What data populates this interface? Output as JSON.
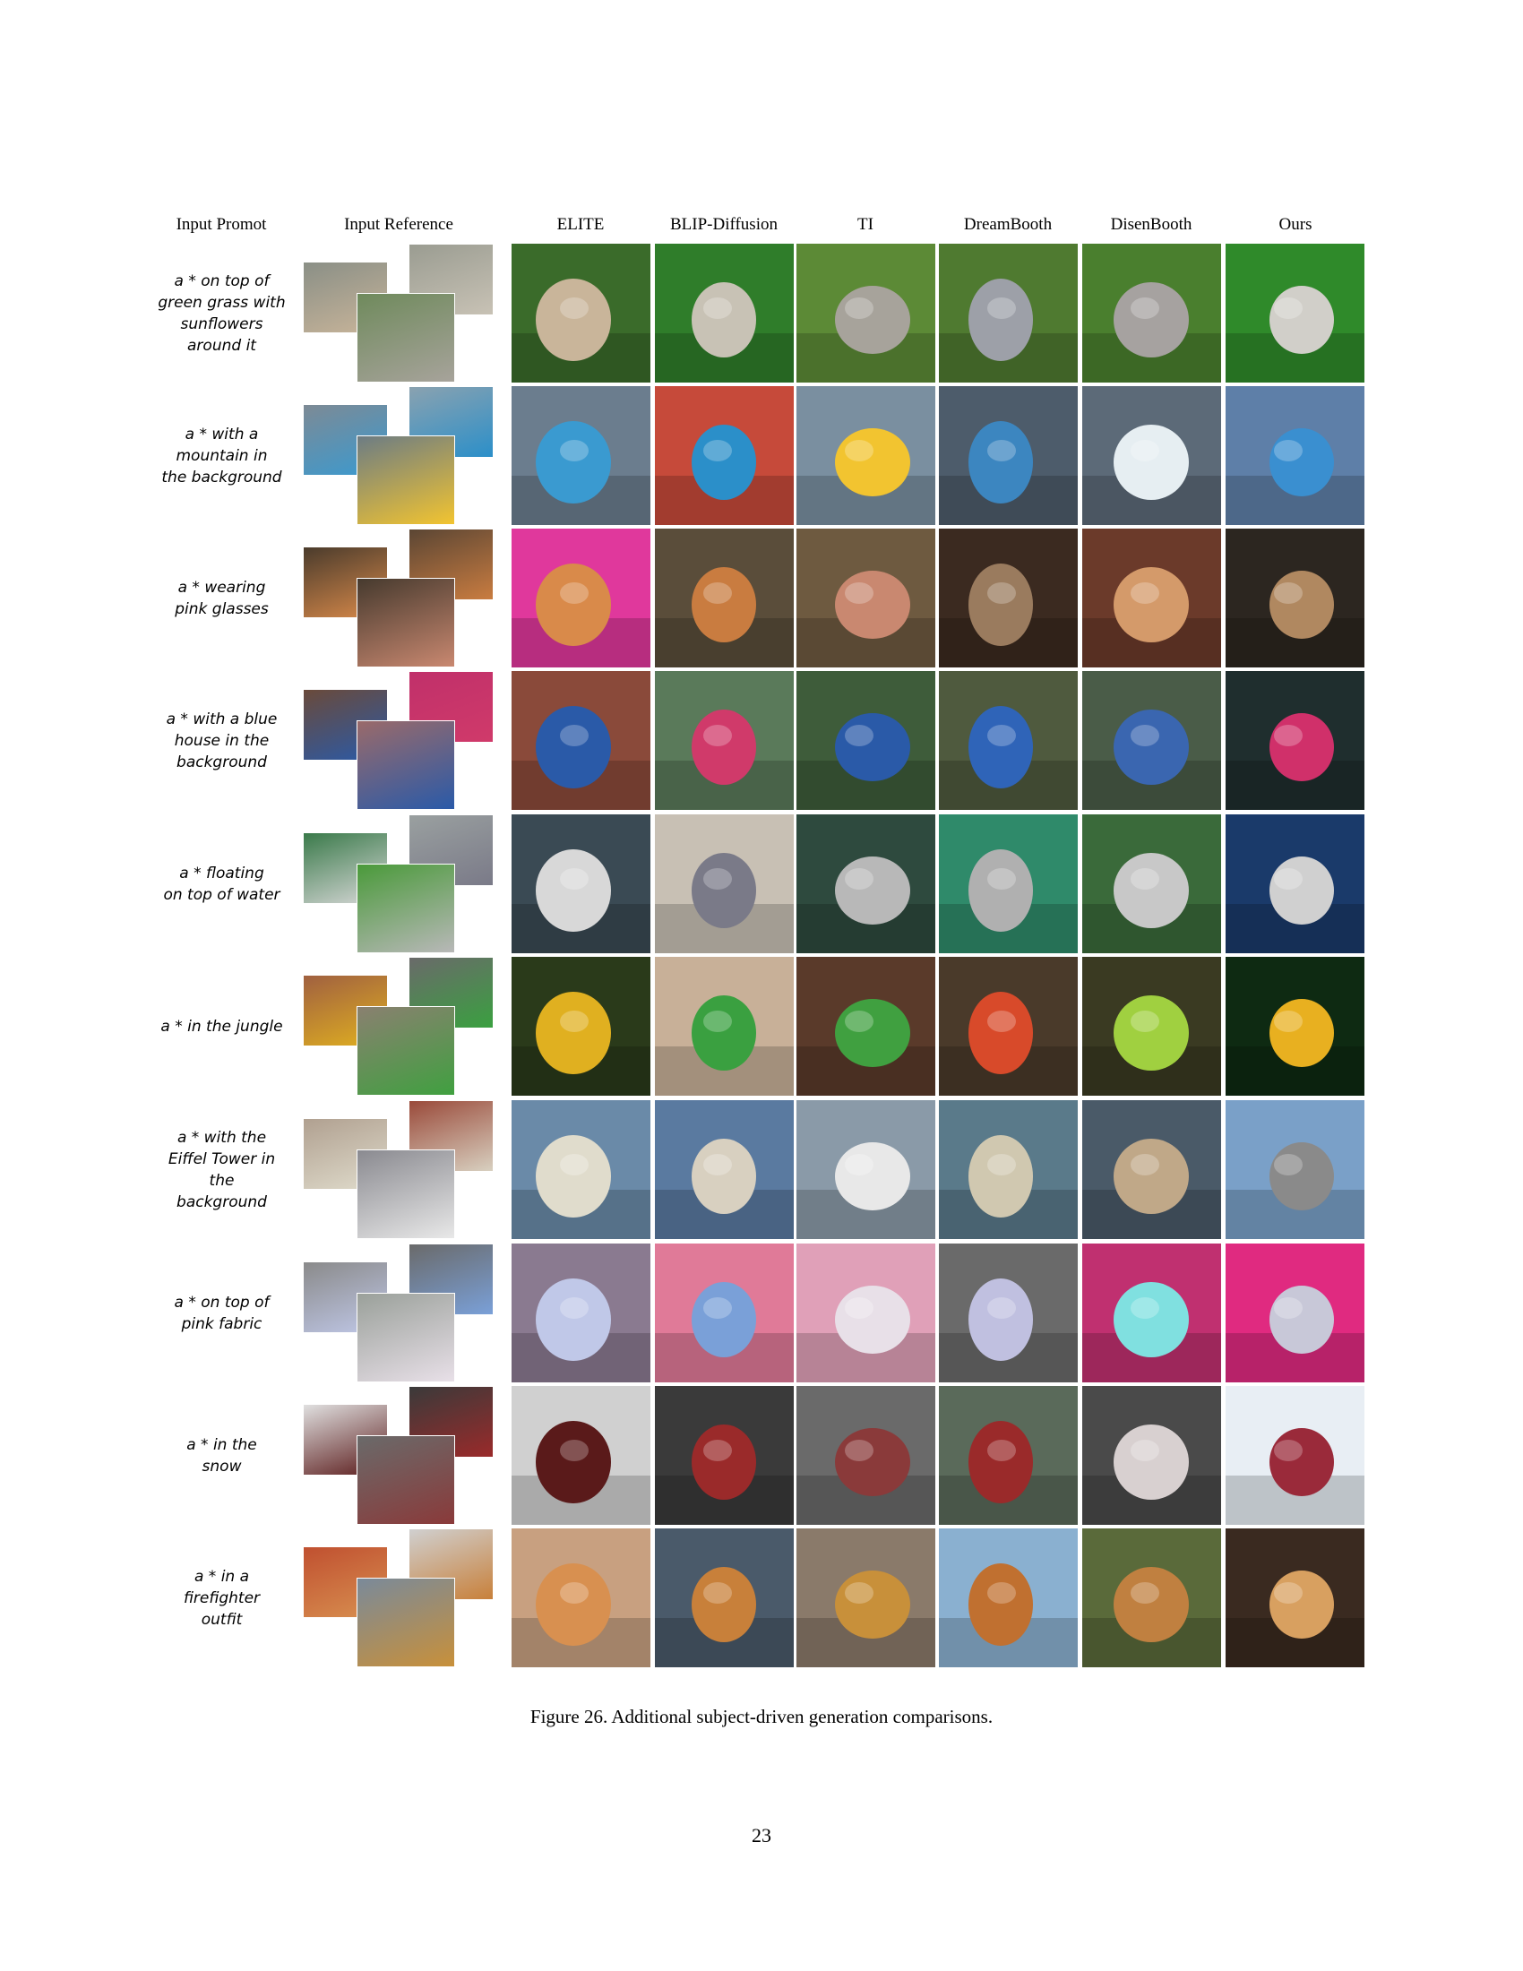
{
  "headers": [
    "Input Promot",
    "Input Reference",
    "ELITE",
    "BLIP-Diffusion",
    "TI",
    "DreamBooth",
    "DisenBooth",
    "Ours"
  ],
  "rows": [
    {
      "prompt": [
        "a * on top of",
        "green grass with",
        "sunflowers",
        "around it"
      ],
      "bg": [
        "#3a6b2a",
        "#2f7d2a",
        "#5c8a36",
        "#4f7a30",
        "#4a7f2e",
        "#2f8a2a"
      ],
      "fg": [
        "#c9b59a",
        "#c8c2b5",
        "#a7a39b",
        "#9da0a8",
        "#a6a2a0",
        "#d1cfc9"
      ],
      "ref": [
        "#8a8f86",
        "#9a9c91",
        "#6f8a5c"
      ]
    },
    {
      "prompt": [
        "a * with a",
        "mountain in",
        "the background"
      ],
      "bg": [
        "#6b7d8e",
        "#c64a3a",
        "#7a8fa0",
        "#4d5c6b",
        "#5c6a78",
        "#5e7fa8"
      ],
      "fg": [
        "#3a9ad0",
        "#2b8fc9",
        "#f2c430",
        "#3c86c0",
        "#e6eef2",
        "#3a8fd0"
      ],
      "ref": [
        "#7d8a95",
        "#8aa2b0",
        "#6c7c84"
      ]
    },
    {
      "prompt": [
        "a * wearing",
        "pink glasses"
      ],
      "bg": [
        "#e0389c",
        "#5a4d3a",
        "#6e5a40",
        "#3b2a20",
        "#6b3a2a",
        "#2c2620"
      ],
      "fg": [
        "#d98a4a",
        "#c97c40",
        "#c98870",
        "#9a7b5e",
        "#d49a6a",
        "#b08860"
      ],
      "ref": [
        "#4a3b2c",
        "#5b4634",
        "#463a2e"
      ]
    },
    {
      "prompt": [
        "a * with a blue",
        "house in the",
        "background"
      ],
      "bg": [
        "#8a4a3a",
        "#5a7a5a",
        "#3e5c3a",
        "#4f5a3e",
        "#4a5c48",
        "#1f2e2e"
      ],
      "fg": [
        "#2a5aa8",
        "#d03a6a",
        "#2a5aa8",
        "#2f64b8",
        "#3a66b0",
        "#d0306a"
      ],
      "ref": [
        "#6a4a3a",
        "#c0306a",
        "#9a6a6a"
      ]
    },
    {
      "prompt": [
        "a * floating",
        "on top of water"
      ],
      "bg": [
        "#3a4a54",
        "#c8c0b4",
        "#2e4a3e",
        "#2f8a6a",
        "#3a6a3a",
        "#1a3a6a"
      ],
      "fg": [
        "#d8d8d8",
        "#7a7a88",
        "#b8b8b8",
        "#b0b0b0",
        "#c8c8c8",
        "#d0d0d0"
      ],
      "ref": [
        "#3a7a4a",
        "#9aa0a0",
        "#4a9a3a"
      ]
    },
    {
      "prompt": [
        "a * in the jungle"
      ],
      "bg": [
        "#2a3a1a",
        "#c8b098",
        "#5a3a2a",
        "#4a3a2a",
        "#3a3a22",
        "#0e2a12"
      ],
      "fg": [
        "#e0b020",
        "#3aa040",
        "#40a040",
        "#d84a2a",
        "#a0d040",
        "#e8b020"
      ],
      "ref": [
        "#a06040",
        "#6a6a6a",
        "#8a8070"
      ]
    },
    {
      "prompt": [
        "a * with the",
        "Eiffel Tower in",
        "the",
        "background"
      ],
      "bg": [
        "#6a8aa8",
        "#5a7aa0",
        "#8a9aa8",
        "#5a7a8a",
        "#4a5a68",
        "#7aa0c8"
      ],
      "fg": [
        "#e0dccc",
        "#d8d0c0",
        "#e8e8e8",
        "#d0c8b0",
        "#c0a888",
        "#8a8a8a"
      ],
      "ref": [
        "#b0a090",
        "#9a4a3a",
        "#8a8a90"
      ]
    },
    {
      "prompt": [
        "a * on top of",
        "pink fabric"
      ],
      "bg": [
        "#8a7a90",
        "#e07a98",
        "#e0a0b8",
        "#6a6a6a",
        "#c03070",
        "#e02a80"
      ],
      "fg": [
        "#c0c8e8",
        "#7aa0d8",
        "#e8e0e8",
        "#c0c0e0",
        "#80e0e0",
        "#c8c8d8"
      ],
      "ref": [
        "#8a8a8a",
        "#6a6a6a",
        "#9aa09a"
      ]
    },
    {
      "prompt": [
        "a * in the",
        "snow"
      ],
      "bg": [
        "#d0d0d0",
        "#3a3a3a",
        "#6a6a6a",
        "#5a6a5a",
        "#4a4a4a",
        "#e8eef4"
      ],
      "fg": [
        "#5a1a1a",
        "#9a2a2a",
        "#8a3a3a",
        "#9a2a2a",
        "#d8d0d0",
        "#9a2a3a"
      ],
      "ref": [
        "#e0e0e0",
        "#3a3a3a",
        "#6a6a6a"
      ]
    },
    {
      "prompt": [
        "a * in a",
        "firefighter",
        "outfit"
      ],
      "bg": [
        "#c8a080",
        "#4a5a6a",
        "#8a7a6a",
        "#8ab0d0",
        "#5a6a3a",
        "#3a2a20"
      ],
      "fg": [
        "#d89050",
        "#c8803a",
        "#c8903a",
        "#c07030",
        "#c08040",
        "#d8a060"
      ],
      "ref": [
        "#c05030",
        "#d0d0d0",
        "#7a8a9a"
      ]
    }
  ],
  "caption": "Figure 26. Additional subject-driven generation comparisons.",
  "page_number": "23"
}
